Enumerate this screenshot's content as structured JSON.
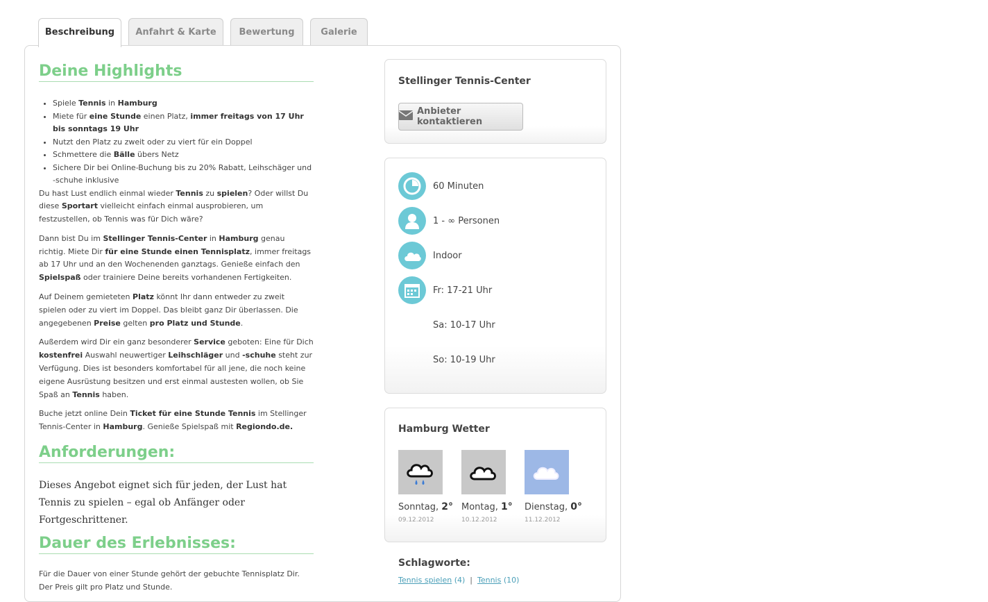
{
  "tabs": [
    {
      "label": "Beschreibung",
      "active": true
    },
    {
      "label": "Anfahrt & Karte",
      "active": false
    },
    {
      "label": "Bewertung",
      "active": false
    },
    {
      "label": "Galerie",
      "active": false
    }
  ],
  "highlights": {
    "title": "Deine Highlights",
    "items": [
      {
        "html": "Spiele <b>Tennis</b> in <b>Hamburg</b>"
      },
      {
        "html": "Miete für <b>eine Stunde</b> einen Platz, <b>immer freitags von 17 Uhr bis sonntags 19 Uhr</b>"
      },
      {
        "html": "Nutzt den Platz zu zweit oder zu viert für ein Doppel"
      },
      {
        "html": "Schmettere die <b>Bälle</b> übers Netz"
      },
      {
        "html": "Sichere Dir bei Online-Buchung bis zu 20% Rabatt, Leihschäger und -schuhe inklusive"
      }
    ],
    "paragraphs": [
      "Du hast Lust endlich einmal wieder <b>Tennis</b> zu <b>spielen</b>? Oder willst Du diese <b>Sportart</b> vielleicht einfach einmal ausprobieren, um festzustellen, ob Tennis was für Dich wäre?",
      "Dann bist Du im <b>Stellinger Tennis-Center</b> in <b>Hamburg</b> genau richtig. Miete Dir <b>für eine Stunde einen Tennisplatz</b>, immer freitags ab 17 Uhr und an den Wochenenden ganztags. Genieße einfach den <b>Spielspaß</b> oder trainiere Deine bereits vorhandenen Fertigkeiten.",
      "Auf Deinem gemieteten <b>Platz</b> könnt Ihr dann entweder zu zweit spielen oder zu viert im Doppel. Das bleibt ganz Dir überlassen. Die angegebenen <b>Preise</b> gelten <b>pro Platz und Stunde</b>.",
      "Außerdem wird Dir ein ganz besonderer <b>Service</b> geboten: Eine für Dich <b>kostenfrei</b> Auswahl neuwertiger <b>Leihschläger</b> und <b>-schuhe</b> steht zur Verfügung. Dies ist besonders komfortabel für all jene, die noch keine eigene Ausrüstung besitzen und erst einmal austesten wollen, ob Sie Spaß an <b>Tennis</b> haben.",
      "Buche jetzt online Dein <b>Ticket für eine Stunde Tennis</b> im Stellinger Tennis-Center in <b>Hamburg</b>. Genieße Spielspaß mit <b>Regiondo.de.</b>"
    ]
  },
  "requirements": {
    "title": "Anforderungen:",
    "text": "Dieses Angebot eignet sich für jeden, der Lust hat Tennis zu spielen – egal ob Anfänger oder Fortgeschrittener."
  },
  "duration": {
    "title": "Dauer des Erlebnisses:",
    "text": "Für die Dauer von einer Stunde gehört der gebuchte Tennisplatz Dir. Der Preis gilt pro Platz und Stunde."
  },
  "provider": {
    "name": "Stellinger Tennis-Center",
    "contact_label": "Anbieter kontaktieren"
  },
  "info": [
    {
      "icon": "clock-icon",
      "value": "60 Minuten"
    },
    {
      "icon": "person-icon",
      "value": "1 - ∞ Personen"
    },
    {
      "icon": "cloud-icon",
      "value": "Indoor"
    },
    {
      "icon": "calendar-icon",
      "value": "Fr: 17-21 Uhr"
    },
    {
      "icon": "",
      "value": "Sa: 10-17 Uhr"
    },
    {
      "icon": "",
      "value": "So: 10-19 Uhr"
    }
  ],
  "weather": {
    "title": "Hamburg Wetter",
    "days": [
      {
        "day": "Sonntag",
        "temp": "2°",
        "date": "09.12.2012",
        "icon": "rain-cloud-icon",
        "bg": "#c8c8c8"
      },
      {
        "day": "Montag",
        "temp": "1°",
        "date": "10.12.2012",
        "icon": "cloud-icon",
        "bg": "#c8c8c8"
      },
      {
        "day": "Dienstag",
        "temp": "0°",
        "date": "11.12.2012",
        "icon": "sunny-cloud-icon",
        "bg": "#9db8e6"
      }
    ]
  },
  "tags": {
    "title": "Schlagworte:",
    "items": [
      {
        "label": "Tennis spielen",
        "count": "(4)"
      },
      {
        "label": "Tennis",
        "count": "(10)"
      }
    ],
    "separator": "|"
  }
}
